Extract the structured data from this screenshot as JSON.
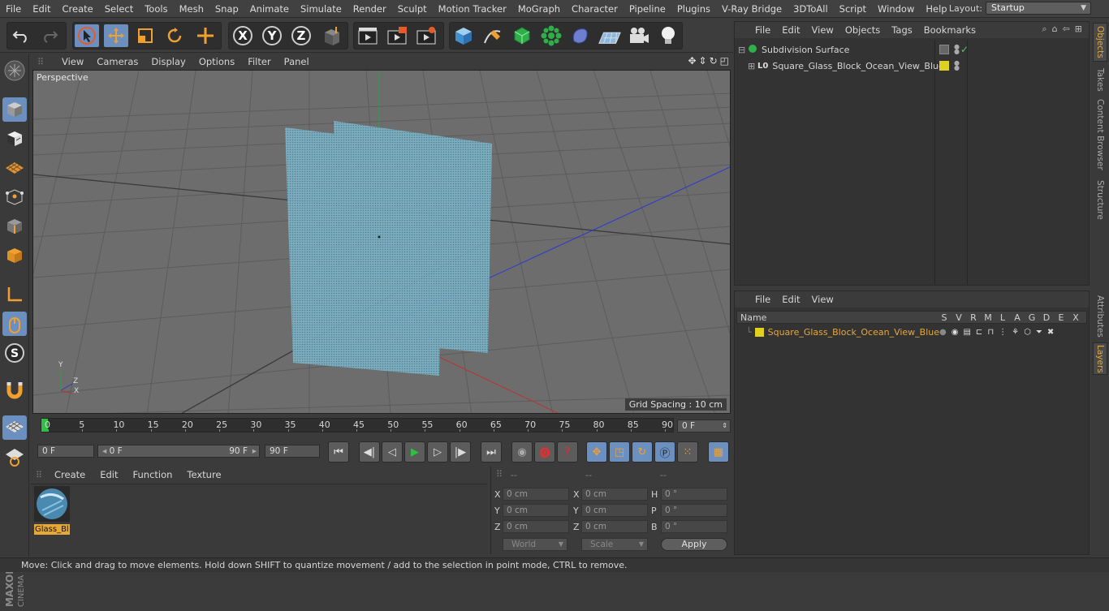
{
  "menubar": {
    "items": [
      "File",
      "Edit",
      "Create",
      "Select",
      "Tools",
      "Mesh",
      "Snap",
      "Animate",
      "Simulate",
      "Render",
      "Sculpt",
      "Motion Tracker",
      "MoGraph",
      "Character",
      "Pipeline",
      "Plugins",
      "V-Ray Bridge",
      "3DToAll",
      "Script",
      "Window",
      "Help"
    ],
    "layout_label": "Layout:",
    "layout_value": "Startup"
  },
  "toolbar": {
    "axis_x": "X",
    "axis_y": "Y",
    "axis_z": "Z"
  },
  "viewport": {
    "menu": [
      "View",
      "Cameras",
      "Display",
      "Options",
      "Filter",
      "Panel"
    ],
    "label": "Perspective",
    "grid_spacing": "Grid Spacing : 10 cm",
    "axis_y": "Y",
    "axis_z": "Z",
    "axis_x": "X"
  },
  "timeline": {
    "ticks": [
      "0",
      "5",
      "10",
      "15",
      "20",
      "25",
      "30",
      "35",
      "40",
      "45",
      "50",
      "55",
      "60",
      "65",
      "70",
      "75",
      "80",
      "85",
      "90"
    ],
    "current_frame": "0 F"
  },
  "transport": {
    "start_field": "0 F",
    "range_start": "0 F",
    "range_end": "90 F",
    "end_field": "90 F"
  },
  "material": {
    "menu": [
      "Create",
      "Edit",
      "Function",
      "Texture"
    ],
    "item_label": "Glass_Bl"
  },
  "coords": {
    "headers": [
      "--",
      "--",
      "--"
    ],
    "rows": [
      {
        "a": "X",
        "av": "0 cm",
        "b": "X",
        "bv": "0 cm",
        "c": "H",
        "cv": "0 °"
      },
      {
        "a": "Y",
        "av": "0 cm",
        "b": "Y",
        "bv": "0 cm",
        "c": "P",
        "cv": "0 °"
      },
      {
        "a": "Z",
        "av": "0 cm",
        "b": "Z",
        "bv": "0 cm",
        "c": "B",
        "cv": "0 °"
      }
    ],
    "world": "World",
    "scale": "Scale",
    "apply": "Apply"
  },
  "objects": {
    "menu": [
      "File",
      "Edit",
      "View",
      "Objects",
      "Tags",
      "Bookmarks"
    ],
    "items": [
      {
        "name": "Subdivision Surface"
      },
      {
        "name": "Square_Glass_Block_Ocean_View_Blue"
      }
    ]
  },
  "layers": {
    "menu": [
      "File",
      "Edit",
      "View"
    ],
    "columns": [
      "Name",
      "S",
      "V",
      "R",
      "M",
      "L",
      "A",
      "G",
      "D",
      "E",
      "X"
    ],
    "row_name": "Square_Glass_Block_Ocean_View_Blue"
  },
  "right_tabs": [
    "Objects",
    "Takes",
    "Content Browser",
    "Structure",
    "Attributes",
    "Layers"
  ],
  "status": "Move: Click and drag to move elements. Hold down SHIFT to quantize movement / add to the selection in point mode, CTRL to remove.",
  "colors": {
    "accent": "#e8a838",
    "highlight": "#6b8fbf",
    "layer_yellow": "#e0d020"
  }
}
